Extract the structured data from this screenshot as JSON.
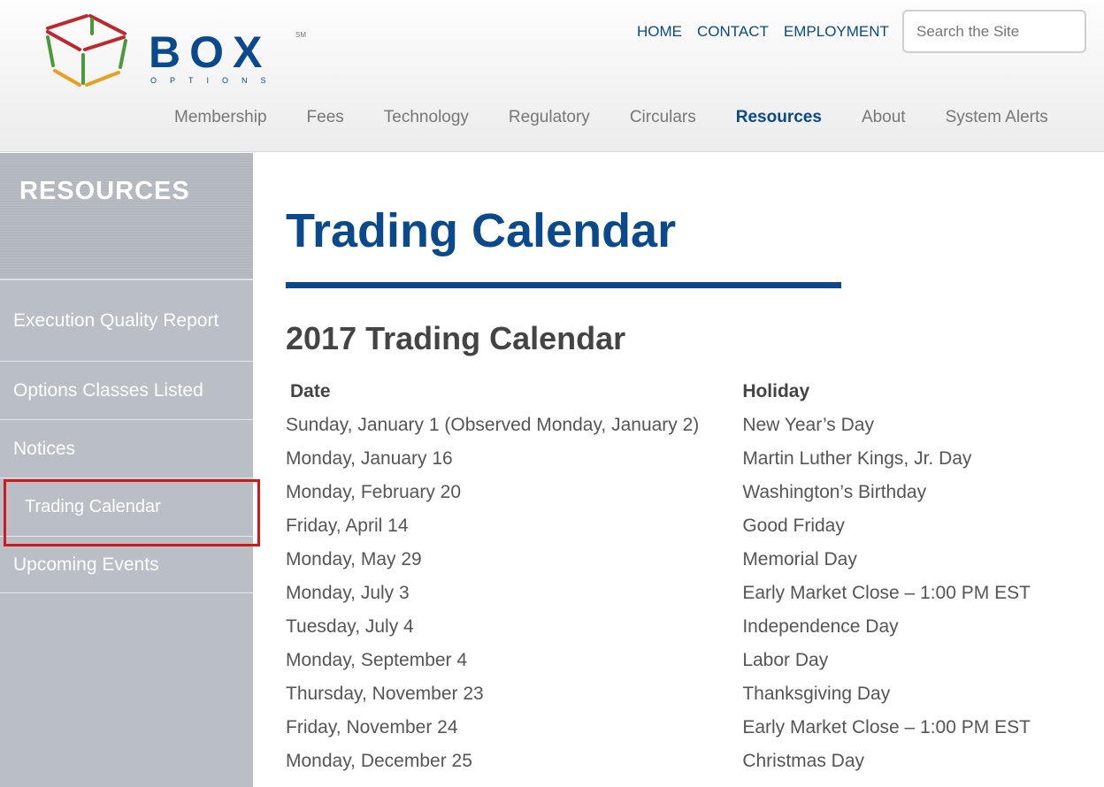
{
  "header": {
    "logo_text": "BOX",
    "logo_sub": "OPTIONS",
    "logo_mark": "SM",
    "top_links": [
      "HOME",
      "CONTACT",
      "EMPLOYMENT"
    ],
    "search_placeholder": "Search the Site",
    "nav": [
      {
        "label": "Membership"
      },
      {
        "label": "Fees"
      },
      {
        "label": "Technology"
      },
      {
        "label": "Regulatory"
      },
      {
        "label": "Circulars"
      },
      {
        "label": "Resources",
        "active": true
      },
      {
        "label": "About"
      },
      {
        "label": "System Alerts"
      }
    ]
  },
  "sidebar": {
    "title": "RESOURCES",
    "items": [
      "Execution Quality Report",
      "Options Classes Listed",
      "Notices",
      "Trading Calendar",
      "Upcoming Events"
    ],
    "selected": "Trading Calendar"
  },
  "main": {
    "title": "Trading Calendar",
    "subtitle": "2017 Trading Calendar",
    "columns": [
      "Date",
      "Holiday"
    ],
    "rows": [
      [
        "Sunday, January 1 (Observed Monday, January 2)",
        "New Year’s Day"
      ],
      [
        "Monday, January 16",
        "Martin Luther Kings, Jr. Day"
      ],
      [
        "Monday, February 20",
        "Washington’s Birthday"
      ],
      [
        "Friday, April 14",
        "Good Friday"
      ],
      [
        "Monday, May 29",
        "Memorial Day"
      ],
      [
        "Monday, July 3",
        "Early Market Close – 1:00 PM EST"
      ],
      [
        "Tuesday, July 4",
        "Independence Day"
      ],
      [
        "Monday, September 4",
        "Labor Day"
      ],
      [
        "Thursday, November 23",
        "Thanksgiving Day"
      ],
      [
        "Friday, November 24",
        "Early Market Close – 1:00 PM EST"
      ],
      [
        "Monday, December 25",
        "Christmas Day"
      ]
    ]
  },
  "colors": {
    "brand": "#0a4a8c",
    "sidebar": "#b9bfc4",
    "highlight": "#d0191c"
  }
}
